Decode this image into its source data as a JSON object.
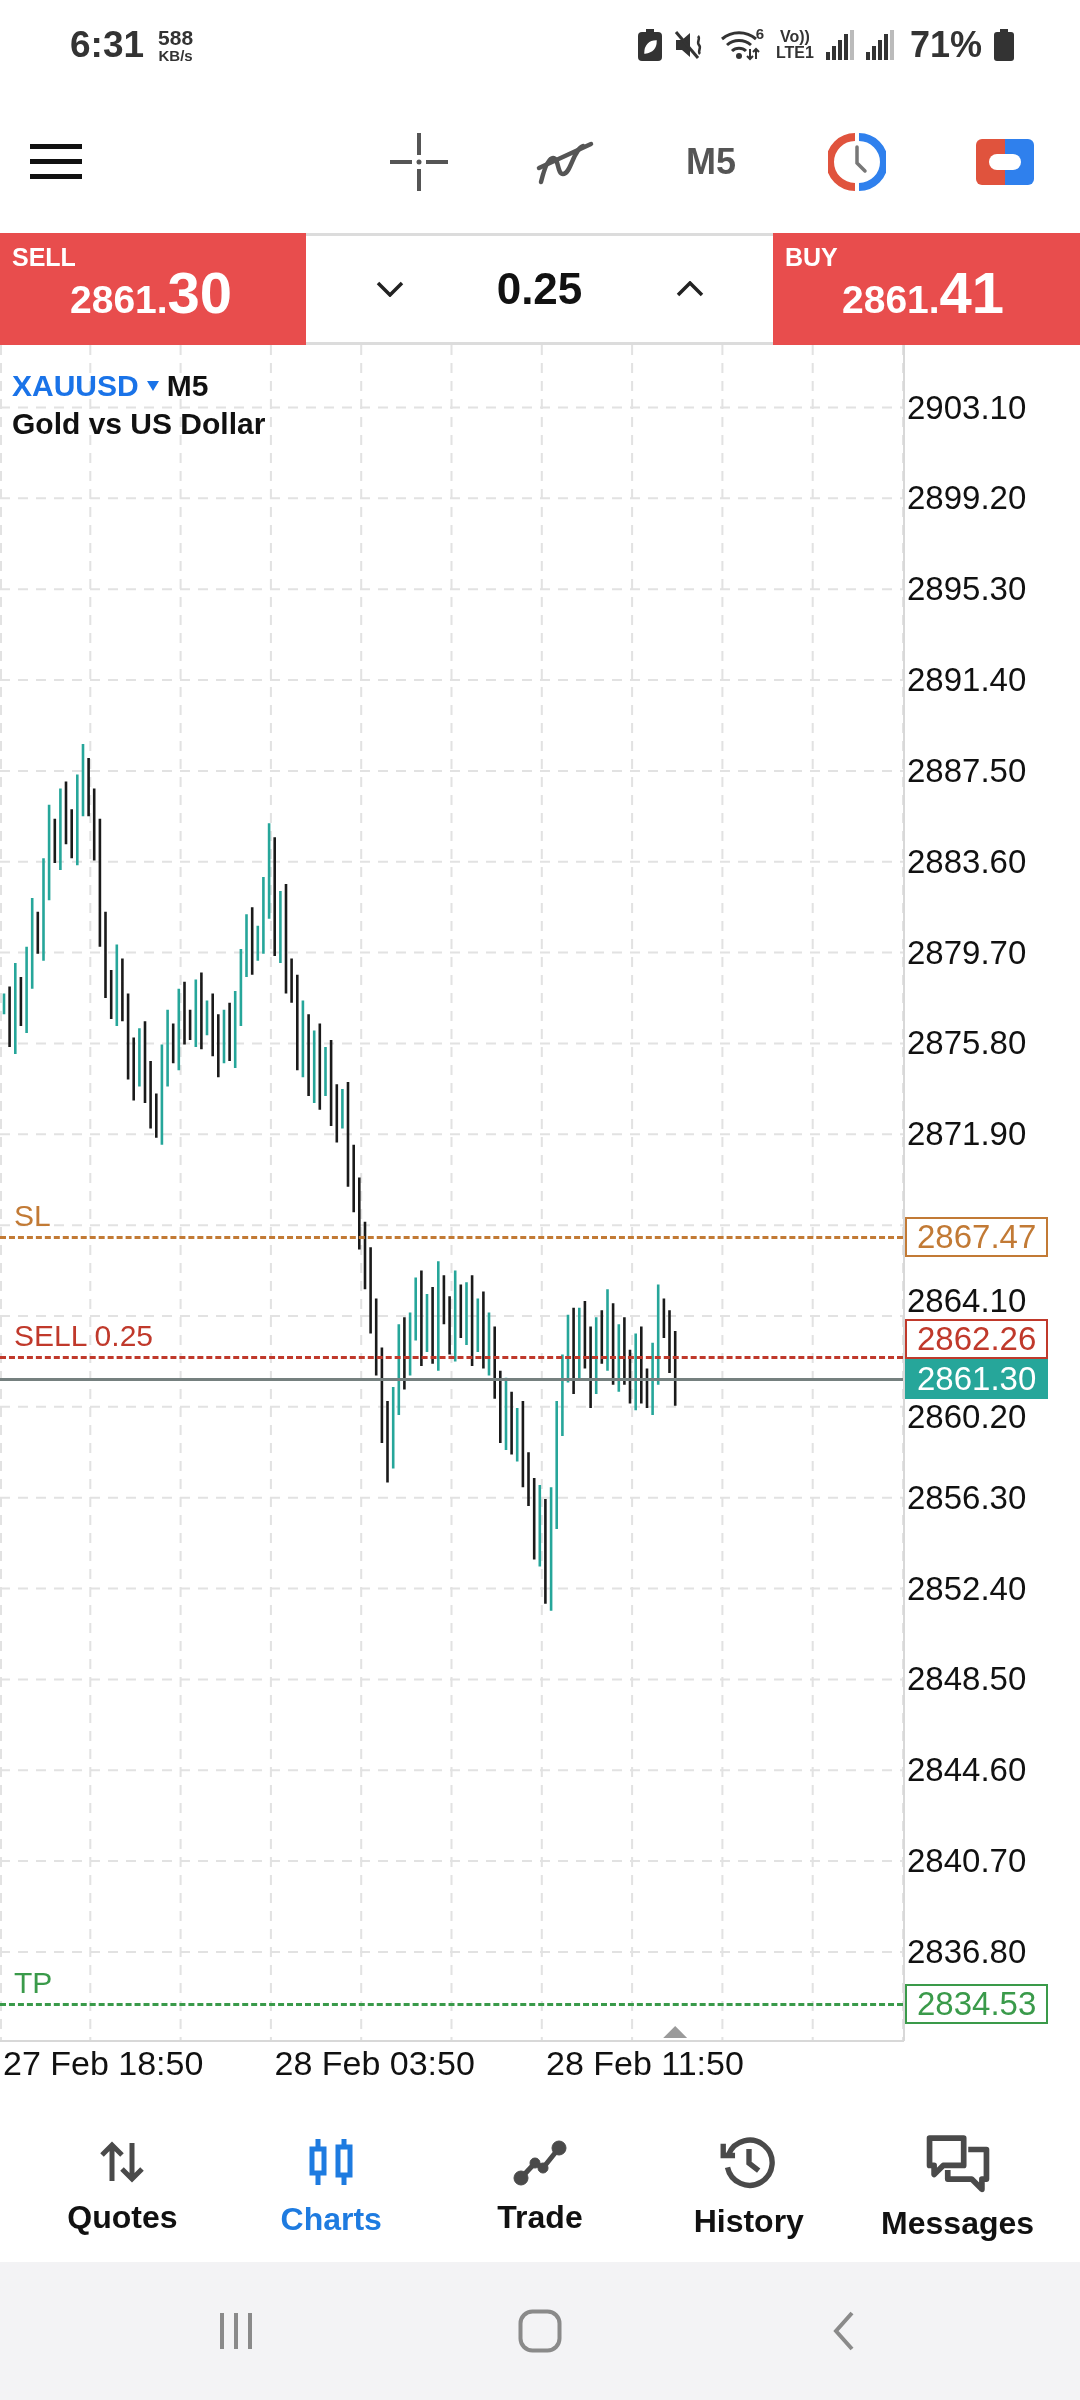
{
  "status_bar": {
    "time": "6:31",
    "speed": "588",
    "speed_unit": "KB/s",
    "wifi_badge": "6",
    "volte": "Vo))",
    "network": "LTE1",
    "battery": "71%"
  },
  "toolbar": {
    "timeframe": "M5"
  },
  "trade_bar": {
    "sell": {
      "label": "SELL",
      "price": "2861.",
      "price_large": "30"
    },
    "volume": "0.25",
    "buy": {
      "label": "BUY",
      "price": "2861.",
      "price_large": "41"
    }
  },
  "chart": {
    "symbol": "XAUUSD",
    "timeframe": "M5",
    "description": "Gold vs US Dollar",
    "price_labels": [
      "2903.10",
      "2899.20",
      "2895.30",
      "2891.40",
      "2887.50",
      "2883.60",
      "2879.70",
      "2875.80",
      "2871.90",
      "2864.10",
      "2860.20",
      "2856.30",
      "2852.40",
      "2848.50",
      "2844.60",
      "2840.70",
      "2836.80"
    ],
    "levels": [
      {
        "kind": "sl",
        "label": "SL",
        "price": "2867.47",
        "color": "#c27a35"
      },
      {
        "kind": "order",
        "label": "SELL 0.25",
        "price": "2862.26",
        "color": "#c0392b"
      },
      {
        "kind": "bid",
        "price": "2861.30",
        "color": "#26a69a"
      },
      {
        "kind": "tp",
        "label": "TP",
        "price": "2834.53",
        "color": "#3a9a4a"
      }
    ],
    "time_labels": [
      "27 Feb 18:50",
      "28 Feb 03:50",
      "28 Feb 11:50"
    ]
  },
  "bottom_nav": [
    {
      "kind": "quotes",
      "label": "Quotes",
      "selected": false
    },
    {
      "kind": "charts",
      "label": "Charts",
      "selected": true
    },
    {
      "kind": "trade",
      "label": "Trade",
      "selected": false
    },
    {
      "kind": "history",
      "label": "History",
      "selected": false
    },
    {
      "kind": "messages",
      "label": "Messages",
      "selected": false
    }
  ]
}
